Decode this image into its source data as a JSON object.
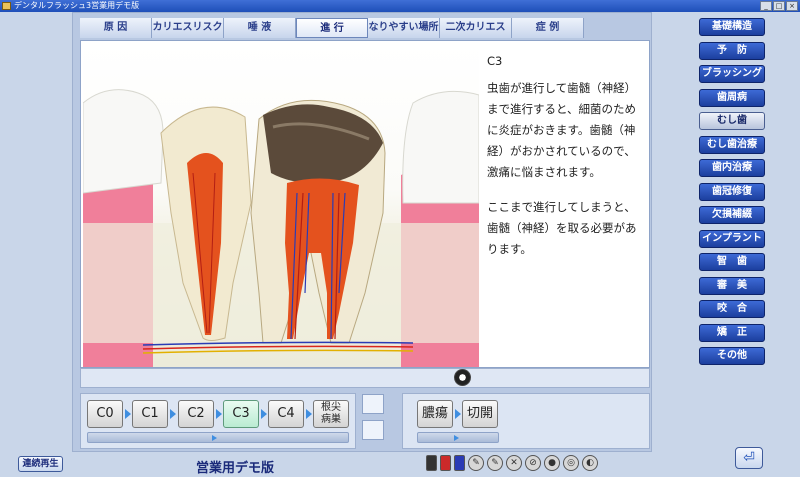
{
  "window": {
    "title": "デンタルフラッシュ3営業用デモ版",
    "controls": [
      "_",
      "□",
      "×"
    ]
  },
  "tabs": [
    {
      "label": "原 因",
      "active": false
    },
    {
      "label": "カリエスリスク",
      "active": false
    },
    {
      "label": "唾 液",
      "active": false
    },
    {
      "label": "進 行",
      "active": true
    },
    {
      "label": "なりやすい場所",
      "active": false
    },
    {
      "label": "二次カリエス",
      "active": false
    },
    {
      "label": "症 例",
      "active": false
    }
  ],
  "description": {
    "stage": "C3",
    "paragraph1": "虫歯が進行して歯髄（神経）まで進行すると、細菌のために炎症がおきます。歯髄（神経）がおかされているので、激痛に悩まされます。",
    "paragraph2": "ここまで進行してしまうと、歯髄（神経）を取る必要があります。"
  },
  "stage_buttons": {
    "c0": "C0",
    "c1": "C1",
    "c2": "C2",
    "c3": "C3",
    "c4": "C4",
    "apical_line1": "根尖",
    "apical_line2": "病巣",
    "active": "C3"
  },
  "symptom_buttons": {
    "abscess": "膿瘍",
    "incision": "切開"
  },
  "status_text": "営業用デモ版",
  "replay_label": "連続再生",
  "sidebar": [
    {
      "label": "基礎構造",
      "active": false
    },
    {
      "label": "予　防",
      "active": false
    },
    {
      "label": "ブラッシング",
      "active": false
    },
    {
      "label": "歯周病",
      "active": false
    },
    {
      "label": "むし歯",
      "active": true
    },
    {
      "label": "むし歯治療",
      "active": false
    },
    {
      "label": "歯内治療",
      "active": false
    },
    {
      "label": "歯冠修復",
      "active": false
    },
    {
      "label": "欠損補綴",
      "active": false
    },
    {
      "label": "インプラント",
      "active": false
    },
    {
      "label": "智　歯",
      "active": false
    },
    {
      "label": "審　美",
      "active": false
    },
    {
      "label": "咬　合",
      "active": false
    },
    {
      "label": "矯　正",
      "active": false
    },
    {
      "label": "その他",
      "active": false
    }
  ],
  "icons": {
    "app": "app-icon",
    "exit": "exit-icon",
    "play": "play-icon",
    "tools": [
      "ink-bottle-black-icon",
      "ink-bottle-red-icon",
      "ink-bottle-blue-icon",
      "pen-icon",
      "marker-icon",
      "eraser-icon",
      "clear-icon",
      "snapshot-icon",
      "zoom-icon",
      "settings-icon"
    ]
  },
  "colors": {
    "accent": "#1e4fb8",
    "sidebar_button": "#2a52b6",
    "active_stage": "#b9ebd2",
    "gum": "#f07f9a",
    "decay": "#5b4a3a"
  }
}
